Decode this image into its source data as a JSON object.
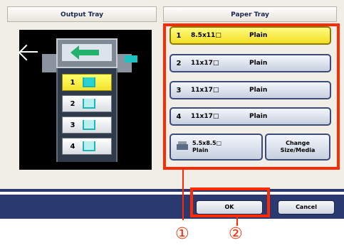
{
  "titles": {
    "output_tray": "Output Tray",
    "paper_tray": "Paper Tray"
  },
  "output_trays": [
    {
      "num": "1"
    },
    {
      "num": "2"
    },
    {
      "num": "3"
    },
    {
      "num": "4"
    }
  ],
  "paper_trays": [
    {
      "num": "1",
      "size": "8.5x11□",
      "type": "Plain"
    },
    {
      "num": "2",
      "size": "11x17□",
      "type": "Plain"
    },
    {
      "num": "3",
      "size": "11x17□",
      "type": "Plain"
    },
    {
      "num": "4",
      "size": "11x17□",
      "type": "Plain"
    }
  ],
  "bypass": {
    "size": "5.5x8.5□",
    "type": "Plain"
  },
  "change_size_media": "Change\nSize/Media",
  "buttons": {
    "ok": "OK",
    "cancel": "Cancel"
  },
  "callouts": [
    "①",
    "②"
  ],
  "colors": {
    "highlight": "#ff2a00",
    "selected": "#f3de22",
    "bar": "#2a3a70"
  }
}
